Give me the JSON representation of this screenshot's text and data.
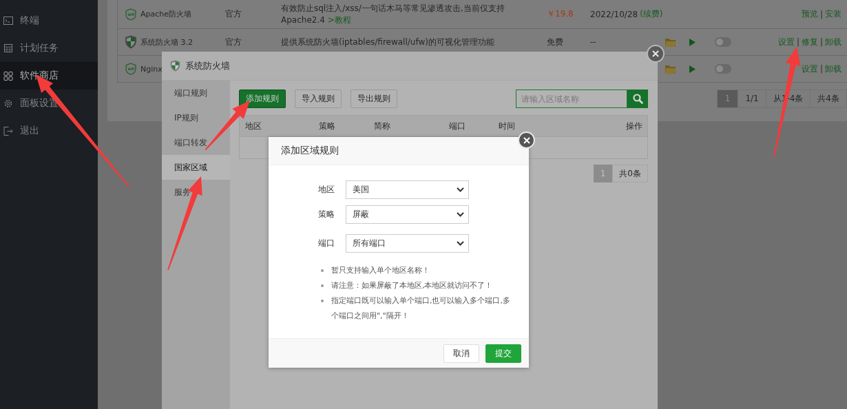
{
  "sidebar": {
    "items": [
      {
        "label": "终端",
        "selected": false
      },
      {
        "label": "计划任务",
        "selected": false
      },
      {
        "label": "软件商店",
        "selected": true
      },
      {
        "label": "面板设置",
        "selected": false
      },
      {
        "label": "退出",
        "selected": false
      }
    ]
  },
  "plugins": {
    "action_separator": "|",
    "rows": [
      {
        "kind": "store",
        "name": "Apache防火墙",
        "source": "官方",
        "description": "有效防止sql注入/xss/一句话木马等常见渗透攻击,当前仅支持Apache2.4 ",
        "link": ">教程",
        "price": "￥19.8",
        "expiry": "2022/10/28",
        "renew": "(续费)",
        "actions": [
          "预览",
          "安装"
        ]
      },
      {
        "kind": "installed",
        "name": "系统防火墙 3.2",
        "source": "官方",
        "description": "提供系统防火墙(iptables/firewall/ufw)的可视化管理功能",
        "price": "免费",
        "expiry": "--",
        "on": false,
        "actions": [
          "设置",
          "修复",
          "卸载"
        ]
      },
      {
        "kind": "installed",
        "name": "Nginx",
        "on": false,
        "actions": [
          "设置",
          "卸载"
        ]
      }
    ],
    "pagination": [
      {
        "label": "1",
        "selected": true
      },
      {
        "label": "1/1",
        "selected": false
      },
      {
        "label": "从1-4条",
        "selected": false
      },
      {
        "label": "共4条",
        "selected": false
      }
    ]
  },
  "firewall_dialog": {
    "title": "系统防火墙",
    "nav": [
      {
        "label": "端口规则",
        "selected": false
      },
      {
        "label": "IP规则",
        "selected": false
      },
      {
        "label": "端口转发",
        "selected": false
      },
      {
        "label": "国家区域",
        "selected": true
      },
      {
        "label": "服务",
        "selected": false
      }
    ],
    "toolbar": [
      {
        "label": "添加规则",
        "kind": "primary"
      },
      {
        "label": "导入规则",
        "kind": "default"
      },
      {
        "label": "导出规则",
        "kind": "default"
      }
    ],
    "search": {
      "placeholder": "请输入区域名称"
    },
    "table": {
      "columns": [
        "地区",
        "策略",
        "简称",
        "端口",
        "时间",
        "操作"
      ]
    },
    "pagination": [
      {
        "label": "1",
        "selected": true
      },
      {
        "label": "共0条",
        "selected": false
      }
    ]
  },
  "add_rule_dialog": {
    "title": "添加区域规则",
    "fields": [
      {
        "label": "地区",
        "value": "美国"
      },
      {
        "label": "策略",
        "value": "屏蔽"
      },
      {
        "label": "端口",
        "value": "所有端口"
      }
    ],
    "notes": [
      "暂只支持输入单个地区名称！",
      "请注意：如果屏蔽了本地区,本地区就访问不了！",
      "指定端口既可以输入单个端口,也可以输入多个端口,多个端口之间用\",\"隔开！"
    ],
    "buttons": [
      {
        "label": "取消",
        "kind": "default"
      },
      {
        "label": "提交",
        "kind": "primary"
      }
    ]
  }
}
